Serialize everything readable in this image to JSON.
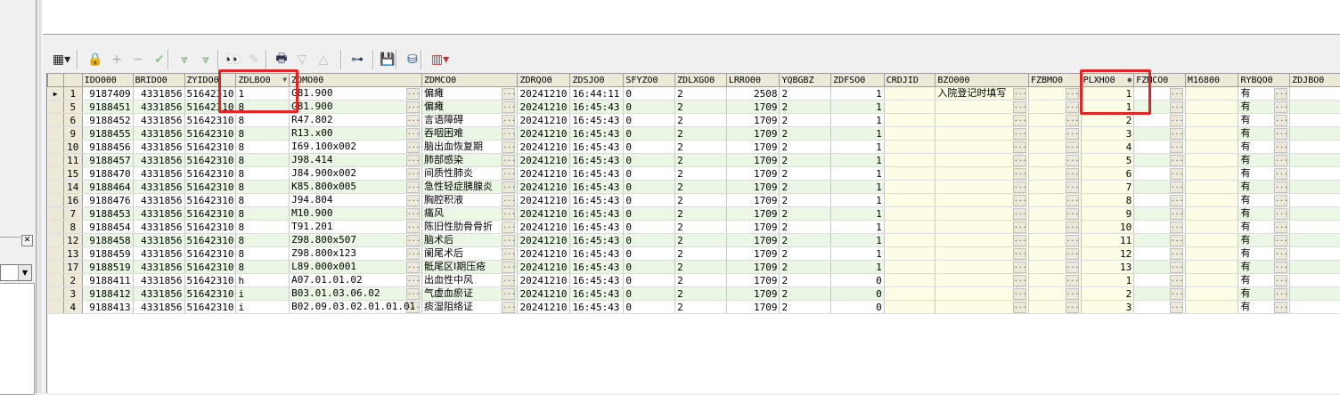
{
  "left_panel": {
    "close_glyph": "✕",
    "combo_glyph": "▼"
  },
  "toolbar": {
    "buttons": [
      {
        "name": "grid-layout-icon",
        "glyph": "▦▾"
      },
      {
        "name": "lock-icon",
        "glyph": "🔒"
      },
      {
        "name": "add-icon",
        "glyph": "+"
      },
      {
        "name": "remove-icon",
        "glyph": "−"
      },
      {
        "name": "confirm-icon",
        "glyph": "✔"
      },
      {
        "name": "expand-down-icon",
        "glyph": "⩔"
      },
      {
        "name": "collapse-down-icon",
        "glyph": "⩔"
      },
      {
        "name": "binoculars-icon",
        "glyph": "👀"
      },
      {
        "name": "clear-filter-icon",
        "glyph": "✎"
      },
      {
        "name": "print-icon",
        "glyph": "🖶"
      },
      {
        "name": "arrow-down-icon",
        "glyph": "▽"
      },
      {
        "name": "arrow-up-icon",
        "glyph": "△"
      },
      {
        "name": "tree-icon",
        "glyph": "⊶"
      },
      {
        "name": "save-icon",
        "glyph": "💾"
      },
      {
        "name": "database-icon",
        "glyph": "⛁"
      },
      {
        "name": "chart-icon",
        "glyph": "▥▾"
      }
    ]
  },
  "grid": {
    "columns": [
      "IDO000",
      "BRIDO0",
      "ZYIDO0",
      "ZDLBO0",
      "ZDMO00",
      "ZDMCO0",
      "ZDRQO0",
      "ZDSJO0",
      "SFYZO0",
      "ZDLXGO0",
      "LRRO00",
      "YQBGBZ",
      "ZDFSO0",
      "CRDJID",
      "BZO000",
      "FZBMO0",
      "PLXHO0",
      "FZMCO0",
      "M16800",
      "RYBQO0",
      "ZDJBO0"
    ],
    "ellipsis": "···",
    "current_row_marker": "▶",
    "rows": [
      {
        "no": "1",
        "cells": [
          "9187409",
          "4331856",
          "51642310",
          "1",
          "G81.900",
          "偏瘫",
          "20241210",
          "16:44:11",
          "0",
          "2",
          "2508",
          "2",
          "1",
          "",
          "入院登记时填写",
          "",
          "1",
          "",
          "",
          "有",
          ""
        ]
      },
      {
        "no": "5",
        "cells": [
          "9188451",
          "4331856",
          "51642310",
          "8",
          "G81.900",
          "偏瘫",
          "20241210",
          "16:45:43",
          "0",
          "2",
          "1709",
          "2",
          "1",
          "",
          "",
          "",
          "1",
          "",
          "",
          "有",
          ""
        ]
      },
      {
        "no": "6",
        "cells": [
          "9188452",
          "4331856",
          "51642310",
          "8",
          "R47.802",
          "言语障碍",
          "20241210",
          "16:45:43",
          "0",
          "2",
          "1709",
          "2",
          "1",
          "",
          "",
          "",
          "2",
          "",
          "",
          "有",
          ""
        ]
      },
      {
        "no": "9",
        "cells": [
          "9188455",
          "4331856",
          "51642310",
          "8",
          "R13.x00",
          "吞咽困难",
          "20241210",
          "16:45:43",
          "0",
          "2",
          "1709",
          "2",
          "1",
          "",
          "",
          "",
          "3",
          "",
          "",
          "有",
          ""
        ]
      },
      {
        "no": "10",
        "cells": [
          "9188456",
          "4331856",
          "51642310",
          "8",
          "I69.100x002",
          "脑出血恢复期",
          "20241210",
          "16:45:43",
          "0",
          "2",
          "1709",
          "2",
          "1",
          "",
          "",
          "",
          "4",
          "",
          "",
          "有",
          ""
        ]
      },
      {
        "no": "11",
        "cells": [
          "9188457",
          "4331856",
          "51642310",
          "8",
          "J98.414",
          "肺部感染",
          "20241210",
          "16:45:43",
          "0",
          "2",
          "1709",
          "2",
          "1",
          "",
          "",
          "",
          "5",
          "",
          "",
          "有",
          ""
        ]
      },
      {
        "no": "15",
        "cells": [
          "9188470",
          "4331856",
          "51642310",
          "8",
          "J84.900x002",
          "间质性肺炎",
          "20241210",
          "16:45:43",
          "0",
          "2",
          "1709",
          "2",
          "1",
          "",
          "",
          "",
          "6",
          "",
          "",
          "有",
          ""
        ]
      },
      {
        "no": "14",
        "cells": [
          "9188464",
          "4331856",
          "51642310",
          "8",
          "K85.800x005",
          "急性轻症胰腺炎",
          "20241210",
          "16:45:43",
          "0",
          "2",
          "1709",
          "2",
          "1",
          "",
          "",
          "",
          "7",
          "",
          "",
          "有",
          ""
        ]
      },
      {
        "no": "16",
        "cells": [
          "9188476",
          "4331856",
          "51642310",
          "8",
          "J94.804",
          "胸腔积液",
          "20241210",
          "16:45:43",
          "0",
          "2",
          "1709",
          "2",
          "1",
          "",
          "",
          "",
          "8",
          "",
          "",
          "有",
          ""
        ]
      },
      {
        "no": "7",
        "cells": [
          "9188453",
          "4331856",
          "51642310",
          "8",
          "M10.900",
          "痛风",
          "20241210",
          "16:45:43",
          "0",
          "2",
          "1709",
          "2",
          "1",
          "",
          "",
          "",
          "9",
          "",
          "",
          "有",
          ""
        ]
      },
      {
        "no": "8",
        "cells": [
          "9188454",
          "4331856",
          "51642310",
          "8",
          "T91.201",
          "陈旧性肋骨骨折",
          "20241210",
          "16:45:43",
          "0",
          "2",
          "1709",
          "2",
          "1",
          "",
          "",
          "",
          "10",
          "",
          "",
          "有",
          ""
        ]
      },
      {
        "no": "12",
        "cells": [
          "9188458",
          "4331856",
          "51642310",
          "8",
          "Z98.800x507",
          "脑术后",
          "20241210",
          "16:45:43",
          "0",
          "2",
          "1709",
          "2",
          "1",
          "",
          "",
          "",
          "11",
          "",
          "",
          "有",
          ""
        ]
      },
      {
        "no": "13",
        "cells": [
          "9188459",
          "4331856",
          "51642310",
          "8",
          "Z98.800x123",
          "阑尾术后",
          "20241210",
          "16:45:43",
          "0",
          "2",
          "1709",
          "2",
          "1",
          "",
          "",
          "",
          "12",
          "",
          "",
          "有",
          ""
        ]
      },
      {
        "no": "17",
        "cells": [
          "9188519",
          "4331856",
          "51642310",
          "8",
          "L89.000x001",
          "骶尾区Ⅰ期压疮",
          "20241210",
          "16:45:43",
          "0",
          "2",
          "1709",
          "2",
          "1",
          "",
          "",
          "",
          "13",
          "",
          "",
          "有",
          ""
        ]
      },
      {
        "no": "2",
        "cells": [
          "9188411",
          "4331856",
          "51642310",
          "h",
          "A07.01.01.02",
          "出血性中风",
          "20241210",
          "16:45:43",
          "0",
          "2",
          "1709",
          "2",
          "0",
          "",
          "",
          "",
          "1",
          "",
          "",
          "有",
          ""
        ]
      },
      {
        "no": "3",
        "cells": [
          "9188412",
          "4331856",
          "51642310",
          "i",
          "B03.01.03.06.02",
          "气虚血瘀证",
          "20241210",
          "16:45:43",
          "0",
          "2",
          "1709",
          "2",
          "0",
          "",
          "",
          "",
          "2",
          "",
          "",
          "有",
          ""
        ]
      },
      {
        "no": "4",
        "cells": [
          "9188413",
          "4331856",
          "51642310",
          "i",
          "B02.09.03.02.01.01.01",
          "痰湿阻络证",
          "20241210",
          "16:45:43",
          "0",
          "2",
          "1709",
          "2",
          "0",
          "",
          "",
          "",
          "3",
          "",
          "",
          "有",
          ""
        ]
      }
    ]
  }
}
